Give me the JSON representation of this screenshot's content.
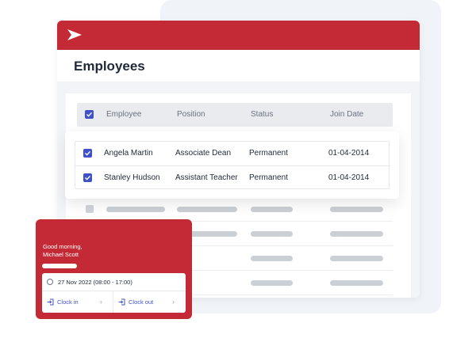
{
  "app": {
    "title": "Employees",
    "brand_color": "#c32a36",
    "accent_color": "#3f51c6"
  },
  "table": {
    "columns": [
      "Employee",
      "Position",
      "Status",
      "Join Date"
    ],
    "rows": [
      {
        "employee": "Angela Martin",
        "position": "Associate Dean",
        "status": "Permanent",
        "join_date": "01-04-2014",
        "checked": true
      },
      {
        "employee": "Stanley Hudson",
        "position": "Assistant Teacher",
        "status": "Permanent",
        "join_date": "01-04-2014",
        "checked": true
      }
    ],
    "placeholder_rows": 4
  },
  "clock_widget": {
    "greeting_line1": "Good morning,",
    "greeting_line2": "Michael Scott",
    "shift": "27 Nov 2022 (08:00 - 17:00)",
    "clock_in_label": "Clock in",
    "clock_out_label": "Clock out",
    "icons": [
      "clock-icon",
      "clock-in-icon",
      "clock-out-icon",
      "chevron-right-icon"
    ]
  }
}
